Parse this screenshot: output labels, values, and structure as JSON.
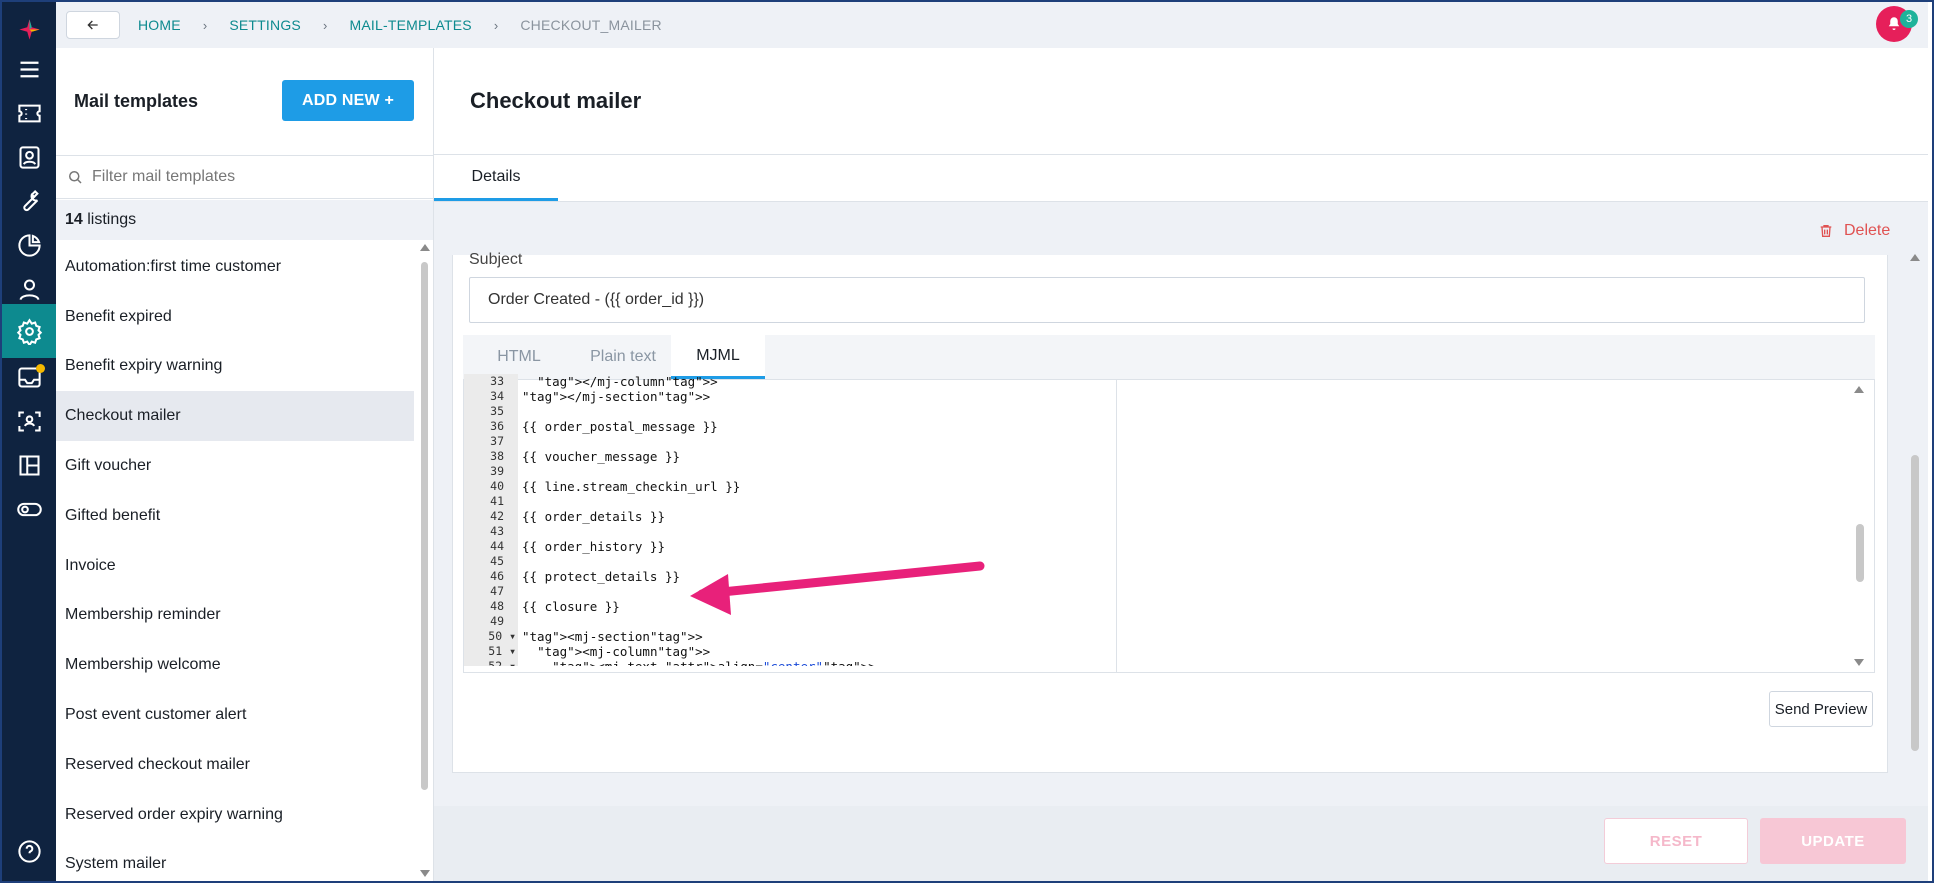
{
  "topbar": {
    "breadcrumbs": [
      "HOME",
      "SETTINGS",
      "MAIL-TEMPLATES",
      "CHECKOUT_MAILER"
    ],
    "notification_count": "3"
  },
  "sidebar_rail": {
    "icons": [
      "menu-icon",
      "ticket-icon",
      "contact-card-icon",
      "wrench-icon",
      "pie-chart-icon",
      "user-icon",
      "settings-icon",
      "inbox-icon",
      "scan-icon",
      "board-icon",
      "toggle-icon",
      "help-icon"
    ],
    "active_icon": "settings-icon",
    "inbox_dot_color": "#f5b800"
  },
  "list_panel": {
    "title": "Mail templates",
    "add_button": "ADD NEW +",
    "filter_placeholder": "Filter mail templates",
    "count": "14",
    "count_label": " listings",
    "items": [
      "Automation:first time customer",
      "Benefit expired",
      "Benefit expiry warning",
      "Checkout mailer",
      "Gift voucher",
      "Gifted benefit",
      "Invoice",
      "Membership reminder",
      "Membership welcome",
      "Post event customer alert",
      "Reserved checkout mailer",
      "Reserved order expiry warning",
      "System mailer"
    ],
    "selected_item": "Checkout mailer"
  },
  "main": {
    "title": "Checkout mailer",
    "tabs": [
      "Details"
    ],
    "delete_label": "Delete",
    "subject_label": "Subject",
    "subject_value": "Order Created - ({{ order_id }})",
    "editor_tabs": [
      "HTML",
      "Plain text",
      "MJML"
    ],
    "active_editor_tab": "MJML",
    "code_lines": [
      {
        "n": "33",
        "fold": "",
        "text": "  </mj-column>"
      },
      {
        "n": "34",
        "fold": "",
        "text": "</mj-section>"
      },
      {
        "n": "35",
        "fold": "",
        "text": ""
      },
      {
        "n": "36",
        "fold": "",
        "text": "{{ order_postal_message }}"
      },
      {
        "n": "37",
        "fold": "",
        "text": ""
      },
      {
        "n": "38",
        "fold": "",
        "text": "{{ voucher_message }}"
      },
      {
        "n": "39",
        "fold": "",
        "text": ""
      },
      {
        "n": "40",
        "fold": "",
        "text": "{{ line.stream_checkin_url }}"
      },
      {
        "n": "41",
        "fold": "",
        "text": ""
      },
      {
        "n": "42",
        "fold": "",
        "text": "{{ order_details }}"
      },
      {
        "n": "43",
        "fold": "",
        "text": ""
      },
      {
        "n": "44",
        "fold": "",
        "text": "{{ order_history }}"
      },
      {
        "n": "45",
        "fold": "",
        "text": ""
      },
      {
        "n": "46",
        "fold": "",
        "text": "{{ protect_details }}"
      },
      {
        "n": "47",
        "fold": "",
        "text": ""
      },
      {
        "n": "48",
        "fold": "",
        "text": "{{ closure }}"
      },
      {
        "n": "49",
        "fold": "",
        "text": ""
      },
      {
        "n": "50",
        "fold": "▾",
        "text": "<mj-section>"
      },
      {
        "n": "51",
        "fold": "▾",
        "text": "  <mj-column>"
      },
      {
        "n": "52",
        "fold": "▾",
        "text": "    <mj-text align=\"center\">"
      }
    ],
    "send_preview": "Send Preview",
    "reset": "RESET",
    "update": "UPDATE"
  },
  "colors": {
    "accent": "#1e9ce6",
    "teal": "#0d8a8f",
    "danger": "#e05252",
    "annotation_arrow": "#e8217a",
    "rail_bg": "#0f2340"
  }
}
